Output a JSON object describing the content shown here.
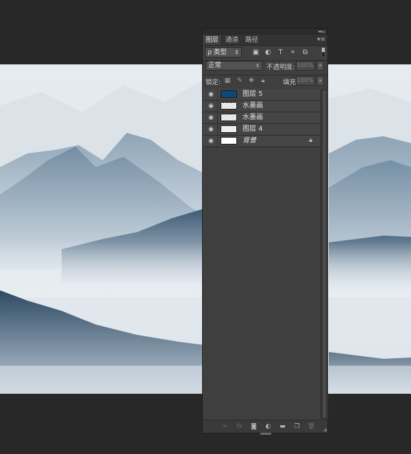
{
  "panel": {
    "tabs": [
      {
        "label": "图层",
        "active": true
      },
      {
        "label": "通道",
        "active": false
      },
      {
        "label": "路径",
        "active": false
      }
    ],
    "filter": {
      "kind_label": "ρ 类型"
    },
    "blend_mode": "正常",
    "opacity_label": "不透明度:",
    "opacity_value": "100%",
    "lock_label": "锁定:",
    "fill_label": "填充:",
    "fill_value": "100%",
    "layers": [
      {
        "name": "图层 5",
        "thumb": "blue",
        "visible": true
      },
      {
        "name": "水墨画",
        "thumb": "checker",
        "visible": true
      },
      {
        "name": "水墨画",
        "thumb": "checker",
        "visible": true
      },
      {
        "name": "图层 4",
        "thumb": "light",
        "visible": true
      },
      {
        "name": "背景",
        "thumb": "white",
        "visible": true,
        "locked": true
      }
    ]
  },
  "colors": {
    "workspace": "#282828",
    "panel_bg": "#3f3f3f",
    "layer_row": "#454545",
    "layer5_thumb": "#0c4a7d"
  }
}
